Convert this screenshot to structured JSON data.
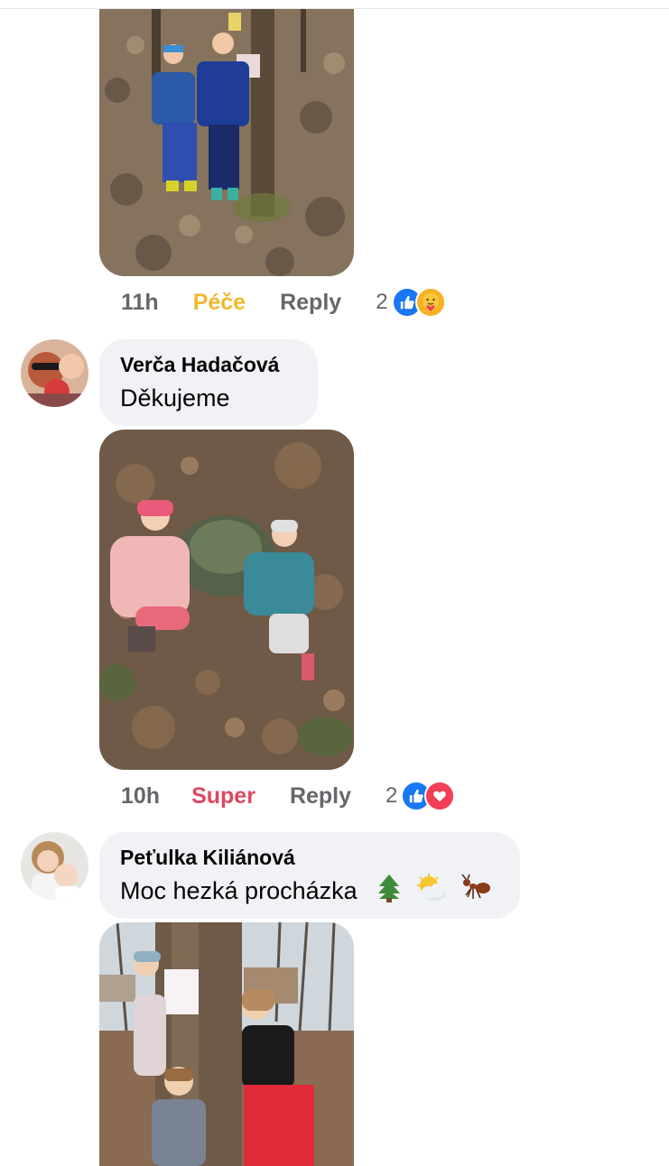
{
  "comments": [
    {
      "photo_alt": "Two boys standing by a tree in the forest",
      "time": "11h",
      "reaction_label": "Péče",
      "reply_label": "Reply",
      "reaction_count": "2",
      "reaction_icons": [
        "like-icon",
        "care-icon"
      ],
      "colors": {
        "reaction": "#f0b92c"
      }
    },
    {
      "author": "Verča Hadačová",
      "text": "Děkujeme",
      "photo_alt": "Two small children sitting by a mossy rock among leaves",
      "time": "10h",
      "reaction_label": "Super",
      "reply_label": "Reply",
      "reaction_count": "2",
      "reaction_icons": [
        "like-icon",
        "love-icon"
      ],
      "colors": {
        "reaction": "#e0475f"
      }
    },
    {
      "author": "Peťulka Kiliánová",
      "text": "Moc hezká procházka",
      "emojis": [
        "tree-emoji",
        "sun-behind-cloud-emoji",
        "ant-emoji"
      ],
      "photo_alt": "Three children hugging a tree"
    }
  ],
  "theme": {
    "bubble_bg": "#f0f2f5",
    "meta_text": "#65676b",
    "like_blue": "#1877f2",
    "love_red": "#f33e58"
  }
}
